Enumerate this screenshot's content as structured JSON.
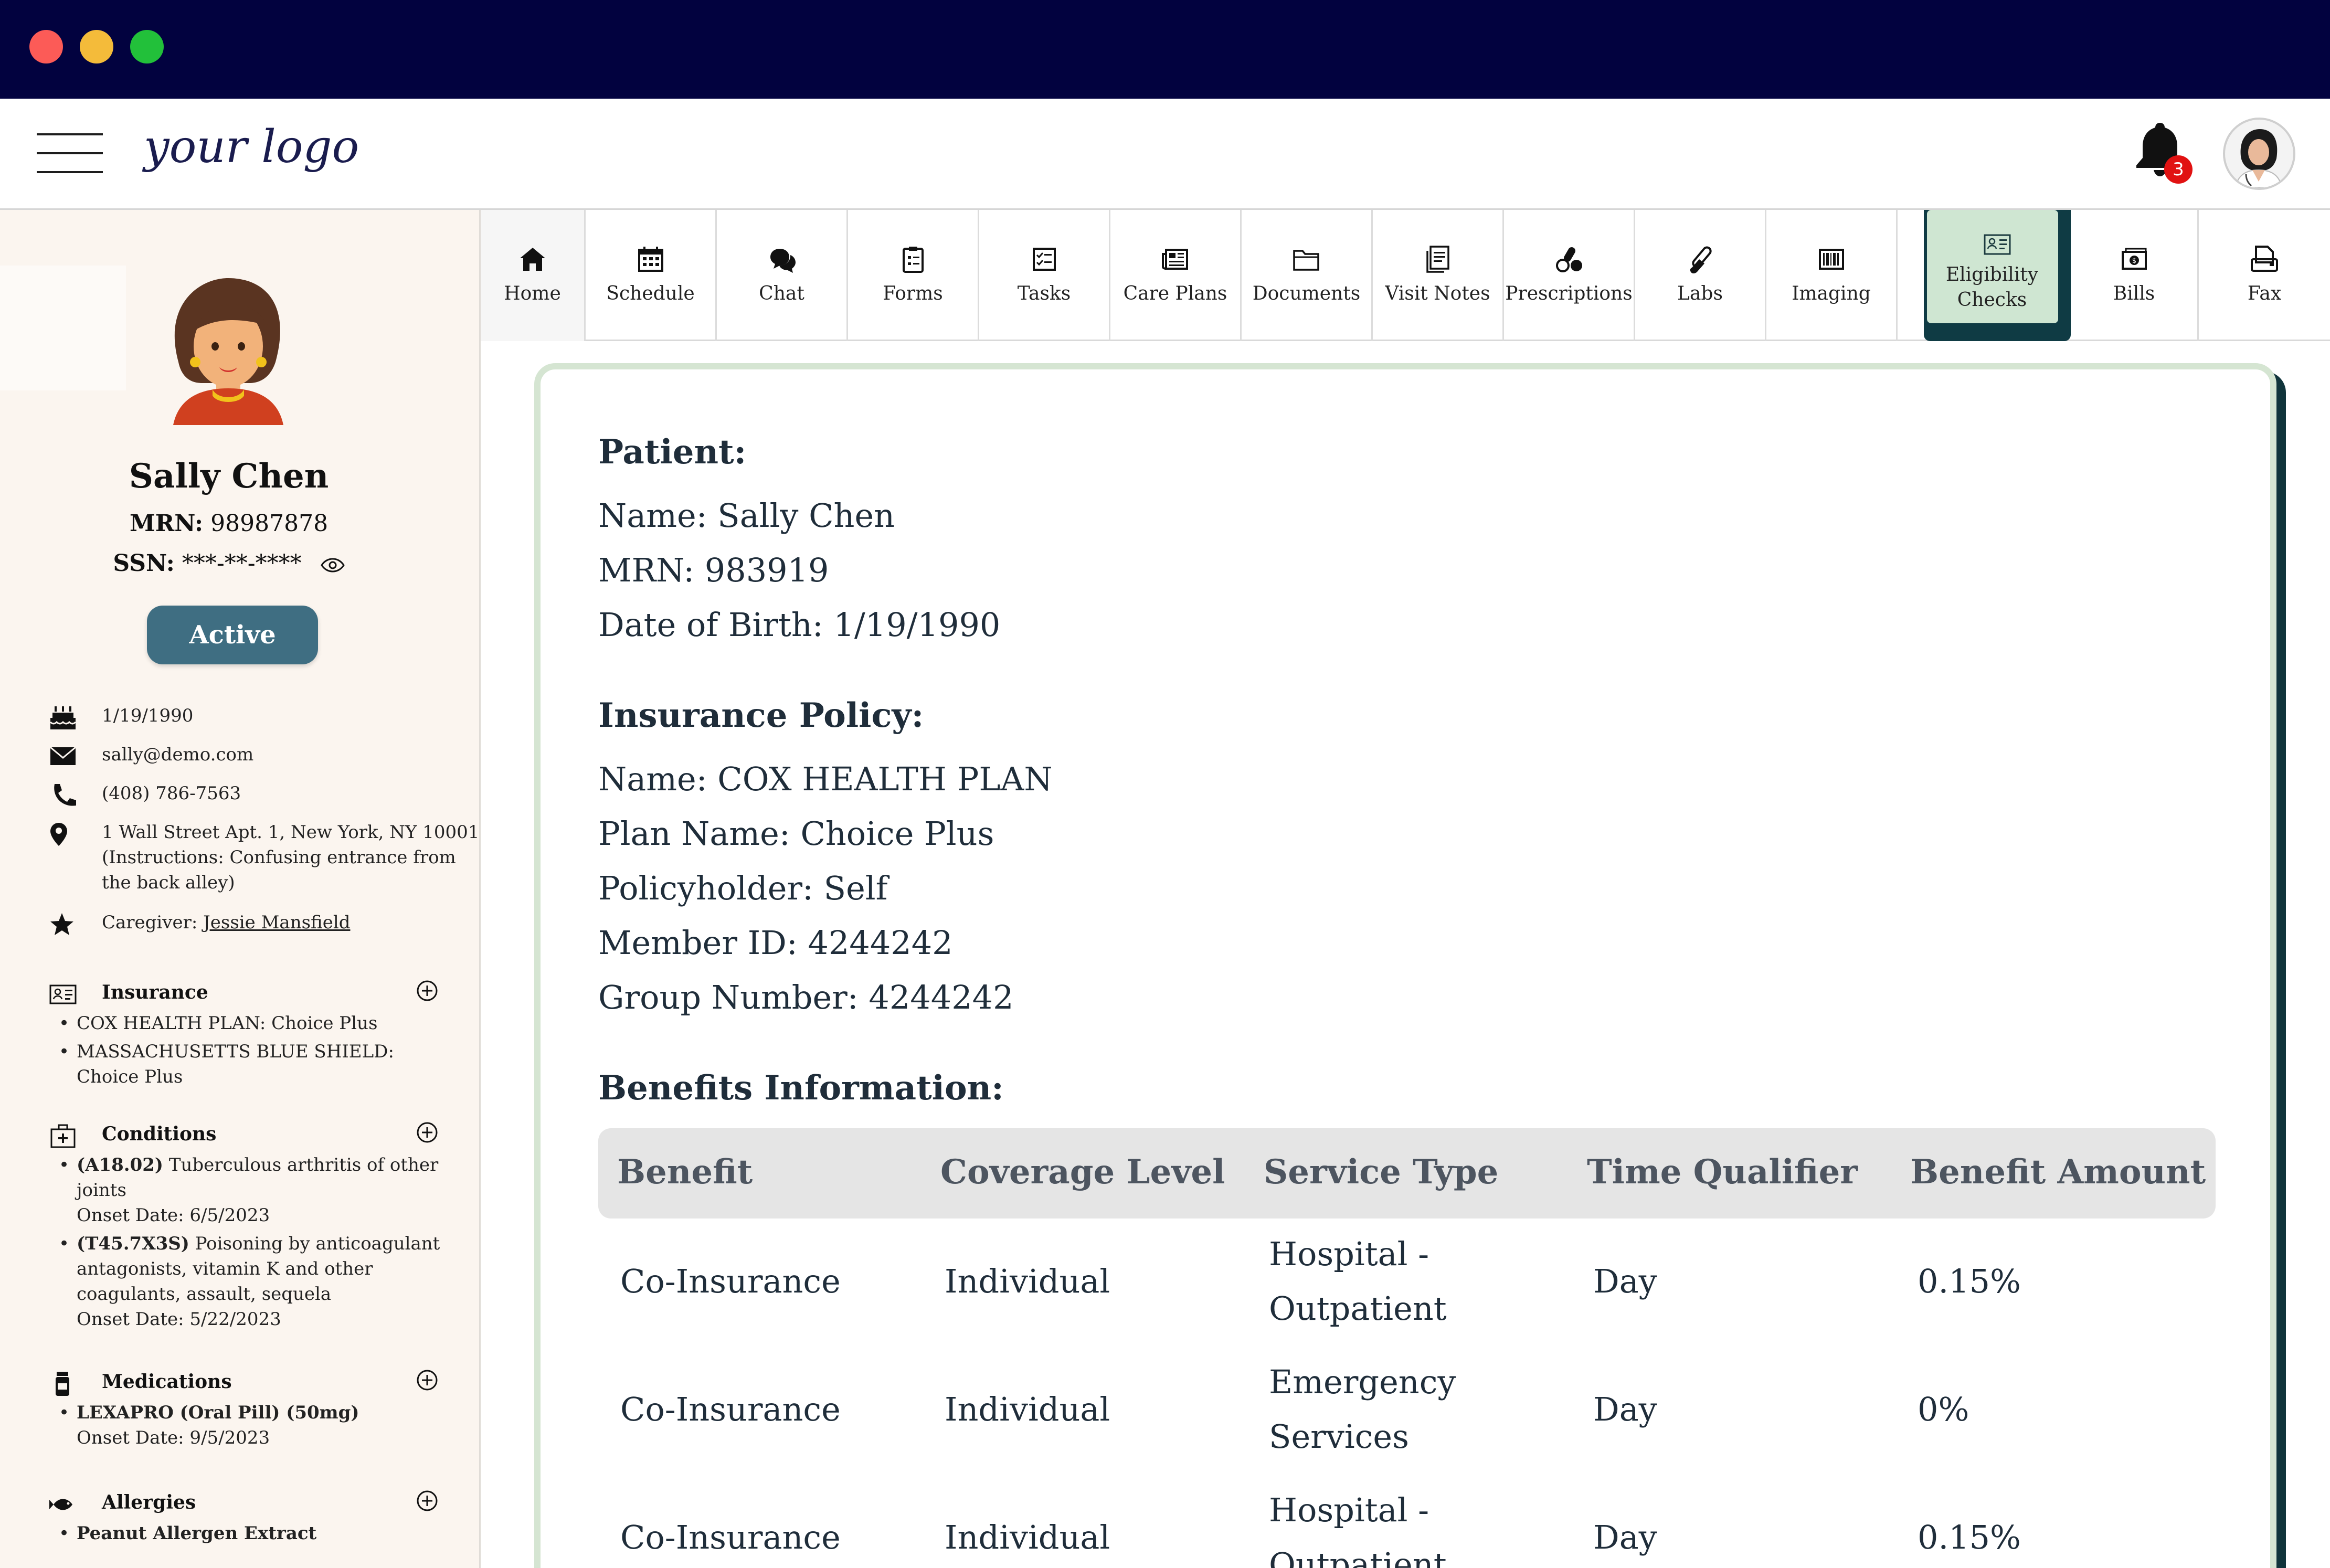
{
  "header": {
    "logo_text": "your logo",
    "notification_count": "3"
  },
  "patient": {
    "name": "Sally Chen",
    "mrn_label": "MRN:",
    "mrn_value": "98987878",
    "ssn_label": "SSN:",
    "ssn_value": "***-**-****",
    "status": "Active",
    "dob": "1/19/1990",
    "email": "sally@demo.com",
    "phone": "(408) 786-7563",
    "address": "1 Wall Street Apt. 1, New York, NY 10001 (Instructions: Confusing entrance from the back alley)",
    "caregiver_label": "Caregiver:",
    "caregiver_name": "Jessie Mansfield"
  },
  "sections": {
    "insurance": {
      "title": "Insurance",
      "items": [
        "COX HEALTH PLAN: Choice Plus",
        "MASSACHUSETTS BLUE SHIELD: Choice Plus"
      ]
    },
    "conditions": {
      "title": "Conditions",
      "items": [
        {
          "code": "(A18.02)",
          "desc": "Tuberculous arthritis of other joints",
          "onset": "Onset Date: 6/5/2023"
        },
        {
          "code": "(T45.7X3S)",
          "desc": "Poisoning by anticoagulant antagonists, vitamin K and other coagulants, assault, sequela",
          "onset": "Onset Date: 5/22/2023"
        }
      ]
    },
    "medications": {
      "title": "Medications",
      "items": [
        {
          "name": "LEXAPRO (Oral Pill) (50mg)",
          "onset": "Onset Date: 9/5/2023"
        }
      ]
    },
    "allergies": {
      "title": "Allergies",
      "items": [
        {
          "name": "Peanut Allergen Extract"
        }
      ]
    }
  },
  "tabs": [
    {
      "label": "Home",
      "icon": "home-icon"
    },
    {
      "label": "Schedule",
      "icon": "calendar-icon"
    },
    {
      "label": "Chat",
      "icon": "chat-icon"
    },
    {
      "label": "Forms",
      "icon": "clipboard-icon"
    },
    {
      "label": "Tasks",
      "icon": "checklist-icon"
    },
    {
      "label": "Care Plans",
      "icon": "newspaper-icon"
    },
    {
      "label": "Documents",
      "icon": "folder-icon"
    },
    {
      "label": "Visit Notes",
      "icon": "notes-icon"
    },
    {
      "label": "Prescriptions",
      "icon": "pills-icon"
    },
    {
      "label": "Labs",
      "icon": "test-tube-icon"
    },
    {
      "label": "Imaging",
      "icon": "barcode-icon"
    },
    {
      "label": "Eligibility Checks",
      "icon": "id-card-icon"
    },
    {
      "label": "Bills",
      "icon": "bill-icon"
    },
    {
      "label": "Fax",
      "icon": "fax-icon"
    }
  ],
  "active_tab": "Eligibility Checks",
  "eligibility": {
    "patient_heading": "Patient:",
    "patient_lines": [
      "Name: Sally Chen",
      "MRN: 983919",
      "Date of Birth: 1/19/1990"
    ],
    "policy_heading": "Insurance Policy:",
    "policy_lines": [
      "Name: COX HEALTH PLAN",
      "Plan Name: Choice Plus",
      "Policyholder: Self",
      "Member ID: 4244242",
      "Group Number: 4244242"
    ],
    "benefits_heading": "Benefits Information:",
    "columns": [
      "Benefit",
      "Coverage Level",
      "Service Type",
      "Time Qualifier",
      "Benefit Amount"
    ],
    "rows": [
      [
        "Co-Insurance",
        "Individual",
        "Hospital - Outpatient",
        "Day",
        "0.15%"
      ],
      [
        "Co-Insurance",
        "Individual",
        "Emergency Services",
        "Day",
        "0%"
      ],
      [
        "Co-Insurance",
        "Individual",
        "Hospital - Outpatient",
        "Day",
        "0.15%"
      ]
    ]
  },
  "colors": {
    "titlebar": "#02023f",
    "accent": "#3f6e82",
    "active_tab": "#cfe6d2",
    "card_border": "#d5e5d2"
  }
}
